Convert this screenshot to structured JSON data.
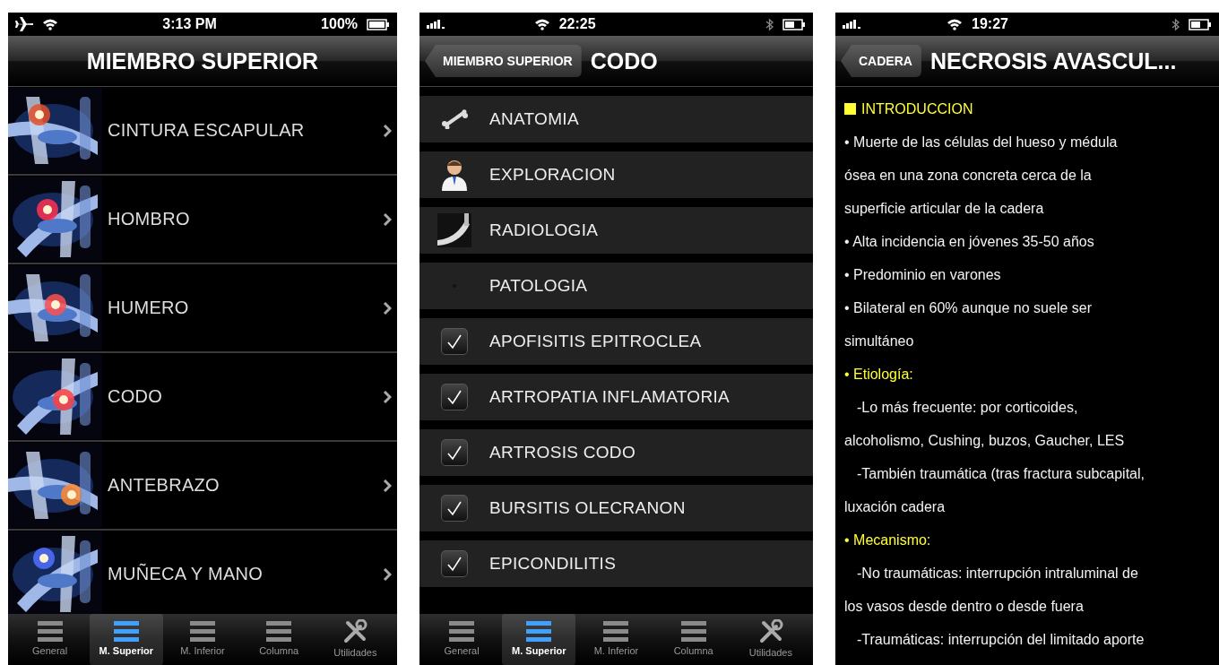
{
  "phone_1": {
    "status_bar": {
      "time": "3:13 PM",
      "battery": "100%"
    },
    "title": "MIEMBRO SUPERIOR",
    "rows": [
      {
        "label": "CINTURA ESCAPULAR"
      },
      {
        "label": "HOMBRO"
      },
      {
        "label": "HUMERO"
      },
      {
        "label": "CODO"
      },
      {
        "label": "ANTEBRAZO"
      },
      {
        "label": "MUÑECA Y MANO"
      }
    ],
    "tab_bar": [
      {
        "label": "General",
        "selected": false,
        "kind": "list"
      },
      {
        "label": "M. Superior",
        "selected": true,
        "kind": "list"
      },
      {
        "label": "M. Inferior",
        "selected": false,
        "kind": "list"
      },
      {
        "label": "Columna",
        "selected": false,
        "kind": "list"
      },
      {
        "label": "Utilidades",
        "selected": false,
        "kind": "tools"
      }
    ]
  },
  "phone_2": {
    "status_bar": {
      "time": "22:25"
    },
    "back_button": "MIEMBRO SUPERIOR",
    "title": "CODO",
    "rows": [
      {
        "label": "ANATOMIA",
        "kind": "bone"
      },
      {
        "label": "EXPLORACION",
        "kind": "doctor"
      },
      {
        "label": "RADIOLOGIA",
        "kind": "xray"
      },
      {
        "label": "PATOLOGIA",
        "kind": "dot"
      },
      {
        "label": "APOFISITIS EPITROCLEA",
        "kind": "checkbox",
        "checked": true
      },
      {
        "label": "ARTROPATIA INFLAMATORIA",
        "kind": "checkbox",
        "checked": true
      },
      {
        "label": "ARTROSIS CODO",
        "kind": "checkbox",
        "checked": true
      },
      {
        "label": "BURSITIS OLECRANON",
        "kind": "checkbox",
        "checked": true
      },
      {
        "label": "EPICONDILITIS",
        "kind": "checkbox",
        "checked": true
      }
    ],
    "tab_bar": [
      {
        "label": "General",
        "selected": false,
        "kind": "list"
      },
      {
        "label": "M. Superior",
        "selected": true,
        "kind": "list"
      },
      {
        "label": "M. Inferior",
        "selected": false,
        "kind": "list"
      },
      {
        "label": "Columna",
        "selected": false,
        "kind": "list"
      },
      {
        "label": "Utilidades",
        "selected": false,
        "kind": "tools"
      }
    ]
  },
  "phone_3": {
    "status_bar": {
      "time": "19:27"
    },
    "back_button": "CADERA",
    "title": "NECROSIS AVASCUL...",
    "lines": [
      {
        "kind": "heading",
        "text": "INTRODUCCION"
      },
      {
        "kind": "text",
        "text": "• Muerte de las células del hueso y médula"
      },
      {
        "kind": "text",
        "text": "ósea en una zona concreta cerca de la"
      },
      {
        "kind": "text",
        "text": "superficie articular de la cadera"
      },
      {
        "kind": "text",
        "text": "• Alta incidencia en jóvenes 35-50 años"
      },
      {
        "kind": "text",
        "text": "• Predominio en varones"
      },
      {
        "kind": "text",
        "text": "• Bilateral en 60% aunque no suele ser"
      },
      {
        "kind": "text",
        "text": "simultáneo"
      },
      {
        "kind": "subheading",
        "text": "• Etiología:"
      },
      {
        "kind": "indent",
        "text": "-Lo más frecuente: por corticoides,"
      },
      {
        "kind": "text",
        "text": "alcoholismo, Cushing, buzos, Gaucher, LES"
      },
      {
        "kind": "indent",
        "text": "-También traumática (tras fractura subcapital,"
      },
      {
        "kind": "text",
        "text": "luxación cadera"
      },
      {
        "kind": "subheading",
        "text": "• Mecanismo:"
      },
      {
        "kind": "indent",
        "text": "-No traumáticas: interrupción intraluminal de"
      },
      {
        "kind": "text",
        "text": "los vasos desde dentro o desde fuera"
      },
      {
        "kind": "indent",
        "text": "-Traumáticas: interrupción del limitado aporte"
      }
    ]
  }
}
